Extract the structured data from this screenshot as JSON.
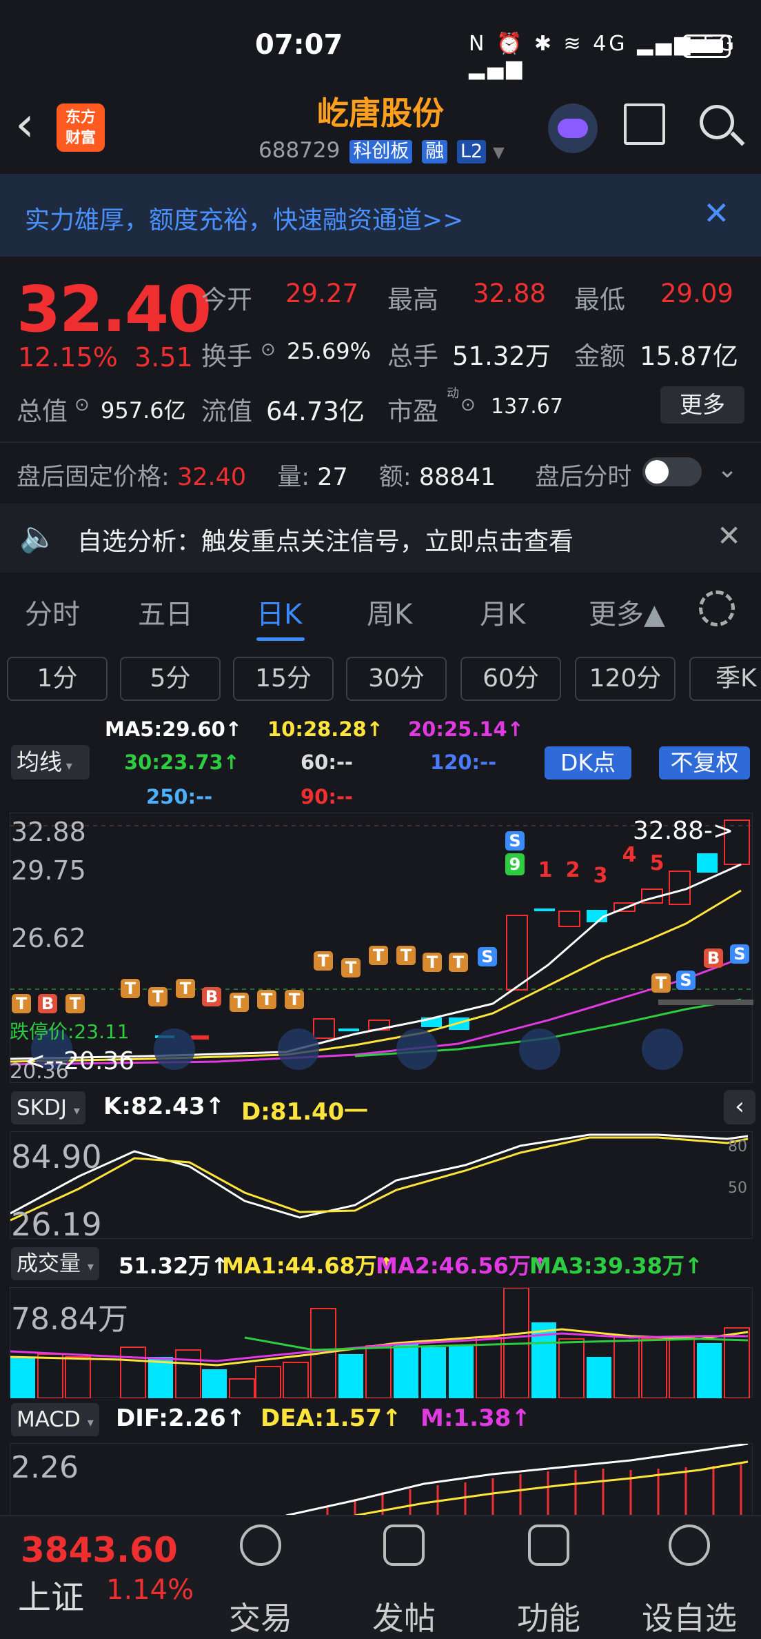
{
  "status": {
    "time": "07:07",
    "icons": "N ⏰ ✱ ≋ 4G ▂▄▆ 5G ▂▄▆"
  },
  "header": {
    "name": "屹唐股份",
    "code": "688729",
    "tags": [
      "科创板",
      "融",
      "L2"
    ],
    "logo_text": "东方\n财富"
  },
  "banner": {
    "text": "实力雄厚，额度充裕，快速融资通道>>"
  },
  "quote": {
    "price": "32.40",
    "pct": "12.15%",
    "chg": "3.51",
    "open_l": "今开",
    "open": "29.27",
    "high_l": "最高",
    "high": "32.88",
    "low_l": "最低",
    "low": "29.09",
    "turnover_l": "换手",
    "turnover": "25.69%",
    "vol_l": "总手",
    "vol": "51.32万",
    "amt_l": "金额",
    "amt": "15.87亿",
    "mcap_l": "总值",
    "mcap": "957.6亿",
    "float_l": "流值",
    "float": "64.73亿",
    "pe_l": "市盈",
    "pe_sup": "动",
    "pe": "137.67",
    "more": "更多"
  },
  "after": {
    "label": "盘后固定价格:",
    "price": "32.40",
    "vol_l": "量:",
    "vol": "27",
    "amt_l": "额:",
    "amt": "88841",
    "tl": "盘后分时"
  },
  "alert": {
    "text": "自选分析：触发重点关注信号，立即点击查看"
  },
  "tabs": [
    "分时",
    "五日",
    "日K",
    "周K",
    "月K",
    "更多▲"
  ],
  "periods": [
    "1分",
    "5分",
    "15分",
    "30分",
    "60分",
    "120分",
    "季K"
  ],
  "ma": {
    "ma5": "MA5:29.60↑",
    "ma10": "10:28.28↑",
    "ma20": "20:25.14↑",
    "ma30": "30:23.73↑",
    "ma60": "60:--",
    "ma120": "120:--",
    "ma250": "250:--",
    "ma90": "90:--",
    "btn": "均线",
    "dk": "DK点",
    "fq": "不复权"
  },
  "kchart": {
    "hi": "32.88",
    "p2": "29.75",
    "p3": "26.62",
    "lo_tag": "<--20.36",
    "hi_tag": "32.88->",
    "limit": "跌停价:23.11",
    "ax_bottom": "20.36"
  },
  "skdj": {
    "label": "SKDJ",
    "k": "K:82.43↑",
    "d": "D:81.40一",
    "max": "84.90",
    "min": "26.19",
    "l80": "80",
    "l50": "50"
  },
  "volume": {
    "label": "成交量",
    "v": "51.32万↑",
    "ma1": "MA1:44.68万↑",
    "ma2": "MA2:46.56万↑",
    "ma3": "MA3:39.38万↑",
    "max": "78.84万"
  },
  "macd": {
    "label": "MACD",
    "dif": "DIF:2.26↑",
    "dea": "DEA:1.57↑",
    "m": "M:1.38↑",
    "max": "2.26"
  },
  "nav": {
    "index_val": "3843.60",
    "index_name": "上证",
    "index_pct": "1.14%",
    "items": [
      "交易",
      "发帖",
      "功能",
      "设自选"
    ]
  }
}
